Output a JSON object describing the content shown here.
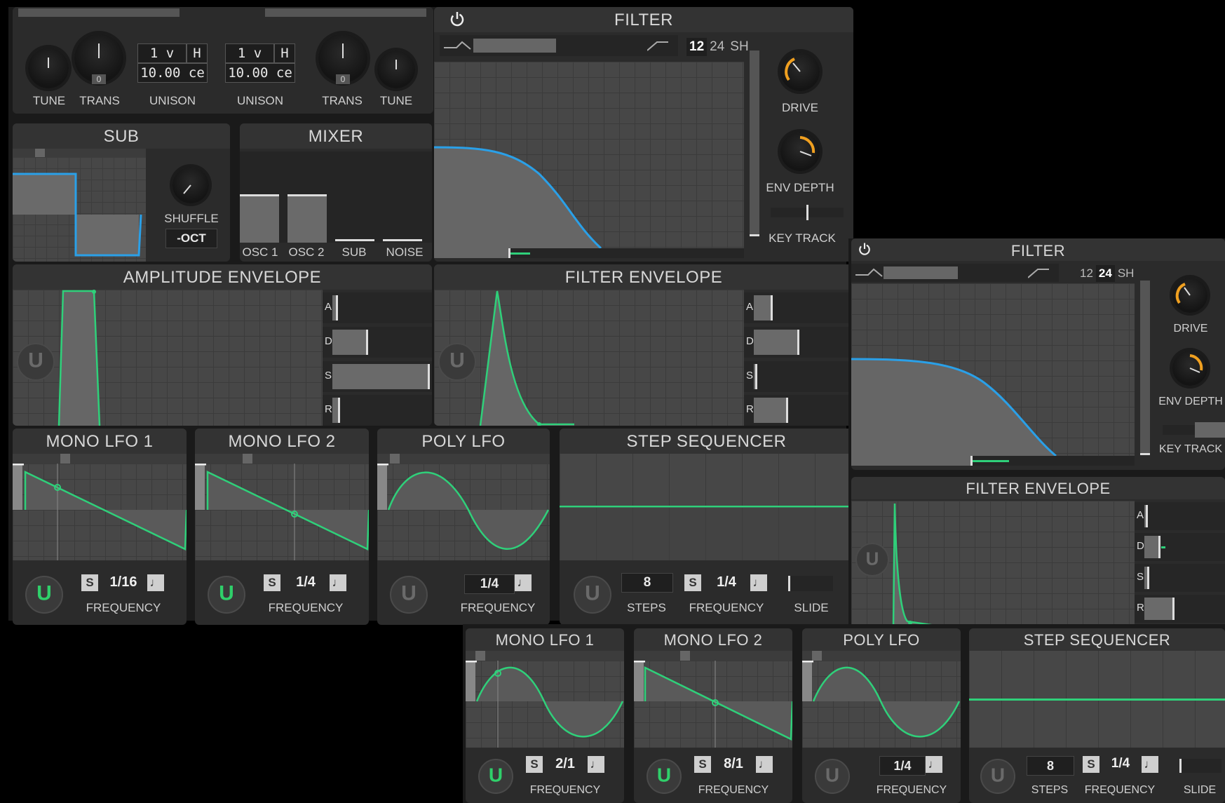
{
  "osc": {
    "tune_left": "TUNE",
    "trans_left": "TRANS",
    "trans_left_value": "0",
    "unison_left": {
      "voices": "1",
      "v": "v",
      "h": "H",
      "detune": "10.00",
      "unit": "ce",
      "label": "UNISON"
    },
    "unison_right": {
      "voices": "1",
      "v": "v",
      "h": "H",
      "detune": "10.00",
      "unit": "ce",
      "label": "UNISON"
    },
    "trans_right": "TRANS",
    "trans_right_value": "0",
    "tune_right": "TUNE"
  },
  "sub": {
    "title": "SUB",
    "shuffle_label": "SHUFFLE",
    "octave": "-OCT"
  },
  "mixer": {
    "title": "MIXER",
    "channels": [
      "OSC 1",
      "OSC 2",
      "SUB",
      "NOISE"
    ],
    "levels": [
      0.55,
      0.55,
      0.03,
      0.03
    ]
  },
  "filter1": {
    "title": "FILTER",
    "tabs": [
      "12",
      "24",
      "SH"
    ],
    "selected_tab": "12",
    "drive": "DRIVE",
    "env_depth": "ENV DEPTH",
    "key_track": "KEY TRACK",
    "accent": "#f0a020",
    "curve": "#2aa0e8"
  },
  "amp_env": {
    "title": "AMPLITUDE ENVELOPE",
    "adsr": [
      "A",
      "D",
      "S",
      "R"
    ],
    "levels": [
      0.03,
      0.38,
      0.98,
      0.06
    ]
  },
  "filter_env1": {
    "title": "FILTER ENVELOPE",
    "adsr": [
      "A",
      "D",
      "S",
      "R"
    ],
    "levels": [
      0.2,
      0.48,
      0.02,
      0.3
    ]
  },
  "lfos1": [
    {
      "title": "MONO LFO 1",
      "s": "S",
      "rate": "1/16",
      "freq": "FREQUENCY",
      "shape": "saw",
      "on": true
    },
    {
      "title": "MONO LFO 2",
      "s": "S",
      "rate": "1/4",
      "freq": "FREQUENCY",
      "shape": "saw",
      "on": true
    },
    {
      "title": "POLY LFO",
      "rate": "1/4",
      "freq": "FREQUENCY",
      "shape": "sine",
      "on": false
    }
  ],
  "seq1": {
    "title": "STEP SEQUENCER",
    "steps": "8",
    "steps_label": "STEPS",
    "s": "S",
    "rate": "1/4",
    "freq": "FREQUENCY",
    "slide": "SLIDE"
  },
  "filter2": {
    "title": "FILTER",
    "tabs": [
      "12",
      "24",
      "SH"
    ],
    "selected_tab": "24",
    "drive": "DRIVE",
    "env_depth": "ENV DEPTH",
    "key_track": "KEY TRACK"
  },
  "filter_env2": {
    "title": "FILTER ENVELOPE",
    "adsr": [
      "A",
      "D",
      "S",
      "R"
    ],
    "levels": [
      0.02,
      0.22,
      0.04,
      0.45
    ]
  },
  "lfos2": [
    {
      "title": "MONO LFO 1",
      "s": "S",
      "rate": "2/1",
      "freq": "FREQUENCY",
      "shape": "sine",
      "on": true
    },
    {
      "title": "MONO LFO 2",
      "s": "S",
      "rate": "8/1",
      "freq": "FREQUENCY",
      "shape": "saw",
      "on": true
    },
    {
      "title": "POLY LFO",
      "rate": "1/4",
      "freq": "FREQUENCY",
      "shape": "sine",
      "on": false
    }
  ],
  "seq2": {
    "title": "STEP SEQUENCER",
    "steps": "8",
    "steps_label": "STEPS",
    "s": "S",
    "rate": "1/4",
    "freq": "FREQUENCY",
    "slide": "SLIDE"
  },
  "colors": {
    "green": "#2fd07a",
    "blue": "#2aa0e8",
    "orange": "#f0a020",
    "panel": "#2b2b2b"
  }
}
